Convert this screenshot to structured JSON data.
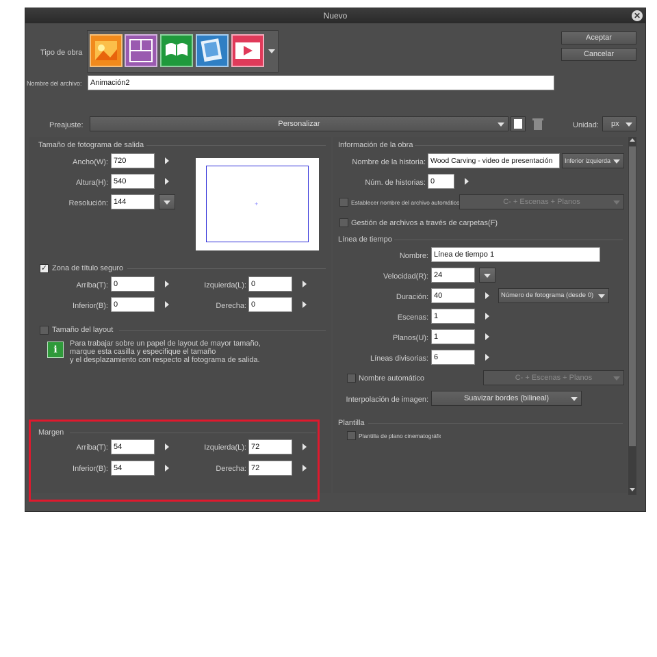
{
  "dialog": {
    "title": "Nuevo"
  },
  "header": {
    "work_type_label": "Tipo de obra",
    "work_types": [
      {
        "name": "illustration",
        "color": "#f18a1c"
      },
      {
        "name": "comic",
        "color": "#9a5ab0"
      },
      {
        "name": "book",
        "color": "#1f9a3c"
      },
      {
        "name": "webtoon",
        "color": "#2f7fc4"
      },
      {
        "name": "animation",
        "color": "#e03a5a"
      }
    ],
    "ok_label": "Aceptar",
    "cancel_label": "Cancelar",
    "filename_label": "Nombre del archivo:",
    "filename_value": "Animación2"
  },
  "preset": {
    "label": "Preajuste:",
    "value": "Personalizar",
    "unit_label": "Unidad:",
    "unit_value": "px"
  },
  "left": {
    "output_frame": {
      "title": "Tamaño de fotograma de salida",
      "width_label": "Ancho(W):",
      "width_value": "720",
      "height_label": "Altura(H):",
      "height_value": "540",
      "resolution_label": "Resolución:",
      "resolution_value": "144"
    },
    "safe_zone": {
      "label": "Zona de título seguro",
      "checked": true,
      "top_label": "Arriba(T):",
      "top_value": "0",
      "left_label": "Izquierda(L):",
      "left_value": "0",
      "bottom_label": "Inferior(B):",
      "bottom_value": "0",
      "right_label": "Derecha:",
      "right_value": "0"
    },
    "layout": {
      "label": "Tamaño del layout",
      "checked": false,
      "info_line1": "Para trabajar sobre un papel de layout de mayor tamaño,",
      "info_line2": "marque esta casilla y especifique el tamaño",
      "info_line3": "y el desplazamiento con respecto al fotograma de salida."
    },
    "margin": {
      "title": "Margen",
      "top_label": "Arriba(T):",
      "top_value": "54",
      "left_label": "Izquierda(L):",
      "left_value": "72",
      "bottom_label": "Inferior(B):",
      "bottom_value": "54",
      "right_label": "Derecha:",
      "right_value": "72",
      "highlight_color": "#e0192d"
    }
  },
  "right": {
    "work_info": {
      "title": "Información de la obra",
      "story_name_label": "Nombre de la historia:",
      "story_name_value": "Wood Carving - video de presentación",
      "position_value": "Inferior izquierda",
      "story_count_label": "Núm. de historias:",
      "story_count_value": "0",
      "auto_filename_label": "Establecer nombre del archivo automático",
      "auto_filename_combo": "C- + Escenas + Planos",
      "folder_mgmt_label": "Gestión de archivos a través de carpetas(F)"
    },
    "timeline": {
      "title": "Línea de tiempo",
      "name_label": "Nombre:",
      "name_value": "Línea de tiempo 1",
      "speed_label": "Velocidad(R):",
      "speed_value": "24",
      "duration_label": "Duración:",
      "duration_value": "40",
      "duration_unit": "Número de fotograma (desde 0)",
      "scenes_label": "Escenas:",
      "scenes_value": "1",
      "shots_label": "Planos(U):",
      "shots_value": "1",
      "dividers_label": "Líneas divisorias:",
      "dividers_value": "6",
      "auto_name_label": "Nombre automático",
      "auto_name_combo": "C- + Escenas + Planos",
      "interp_label": "Interpolación de imagen:",
      "interp_value": "Suavizar bordes (bilineal)"
    },
    "template": {
      "title": "Plantilla",
      "cinema_label": "Plantilla de plano cinematográfico"
    }
  }
}
